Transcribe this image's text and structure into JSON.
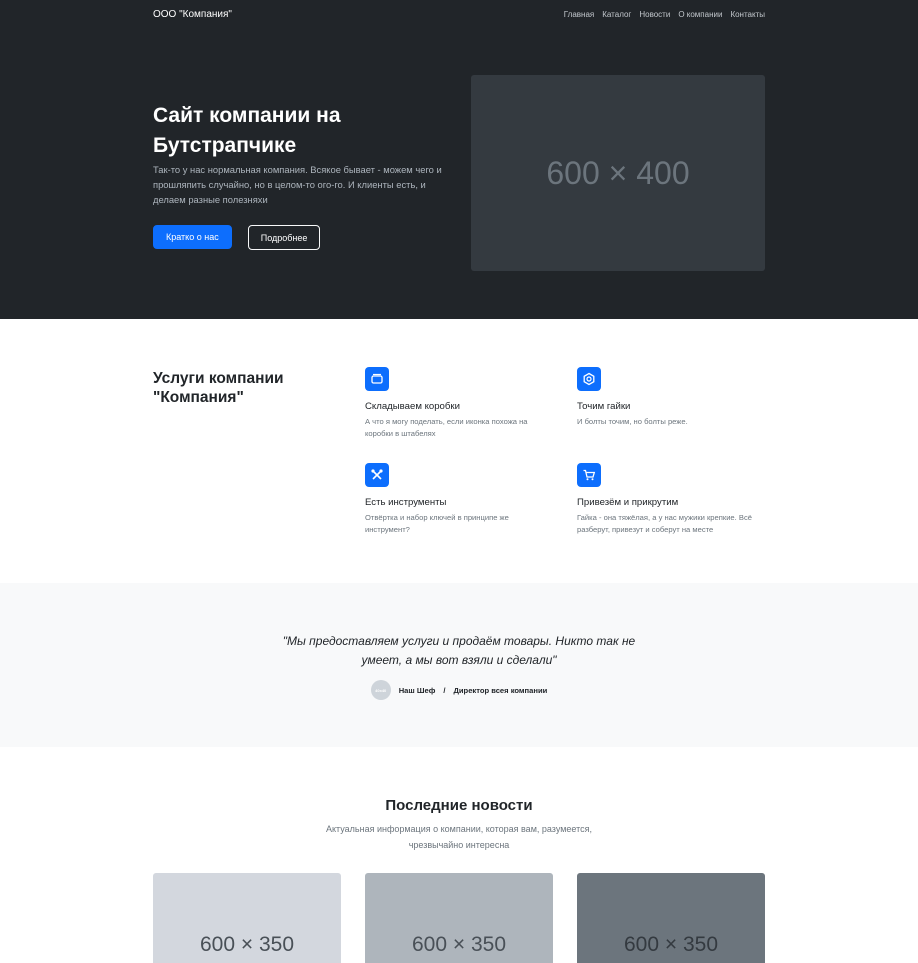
{
  "navbar": {
    "brand": "ООО \"Компания\"",
    "links": [
      "Главная",
      "Каталог",
      "Новости",
      "О компании",
      "Контакты"
    ]
  },
  "hero": {
    "title": "Сайт компании на Бутстрапчике",
    "lead": "Так-то у нас нормальная компания. Всякое бывает - можем чего и прошляпить случайно, но в целом-то ого-го. И клиенты есть, и делаем разные полезняхи",
    "primary_button": "Кратко о нас",
    "secondary_button": "Подробнее",
    "image_placeholder": "600 × 400"
  },
  "services": {
    "title": "Услуги компании \"Компания\"",
    "items": [
      {
        "icon": "box-icon",
        "title": "Складываем коробки",
        "text": "А что я могу поделать, если иконка похожа на коробки в штабелях"
      },
      {
        "icon": "nut-icon",
        "title": "Точим гайки",
        "text": "И болты точим, но болты реже."
      },
      {
        "icon": "tools-icon",
        "title": "Есть инструменты",
        "text": "Отвёртка и набор ключей в принципе же инструмент?"
      },
      {
        "icon": "cart-icon",
        "title": "Привезём и прикрутим",
        "text": "Гайка - она тяжёлая, а у нас мужики крепкие. Всё разберут, привезут и соберут на месте"
      }
    ]
  },
  "testimonial": {
    "quote": "\"Мы предоставляем услуги и продаём товары. Никто так не умеет, а мы вот взяли и сделали\"",
    "avatar_text": "40x40",
    "author": "Наш Шеф",
    "separator": "/",
    "position": "Директор всея компании"
  },
  "news": {
    "title": "Последние новости",
    "subtitle": "Актуальная информация о компании, которая вам, разумеется, чрезвычайно интересна",
    "cards": [
      {
        "placeholder": "600 × 350",
        "bg": "#d3d7de"
      },
      {
        "placeholder": "600 × 350",
        "bg": "#aeb5bc"
      },
      {
        "placeholder": "600 × 350",
        "bg": "#6c757d"
      }
    ]
  },
  "colors": {
    "dark": "#212529",
    "primary": "#0d6efd",
    "light": "#f8f9fa"
  }
}
